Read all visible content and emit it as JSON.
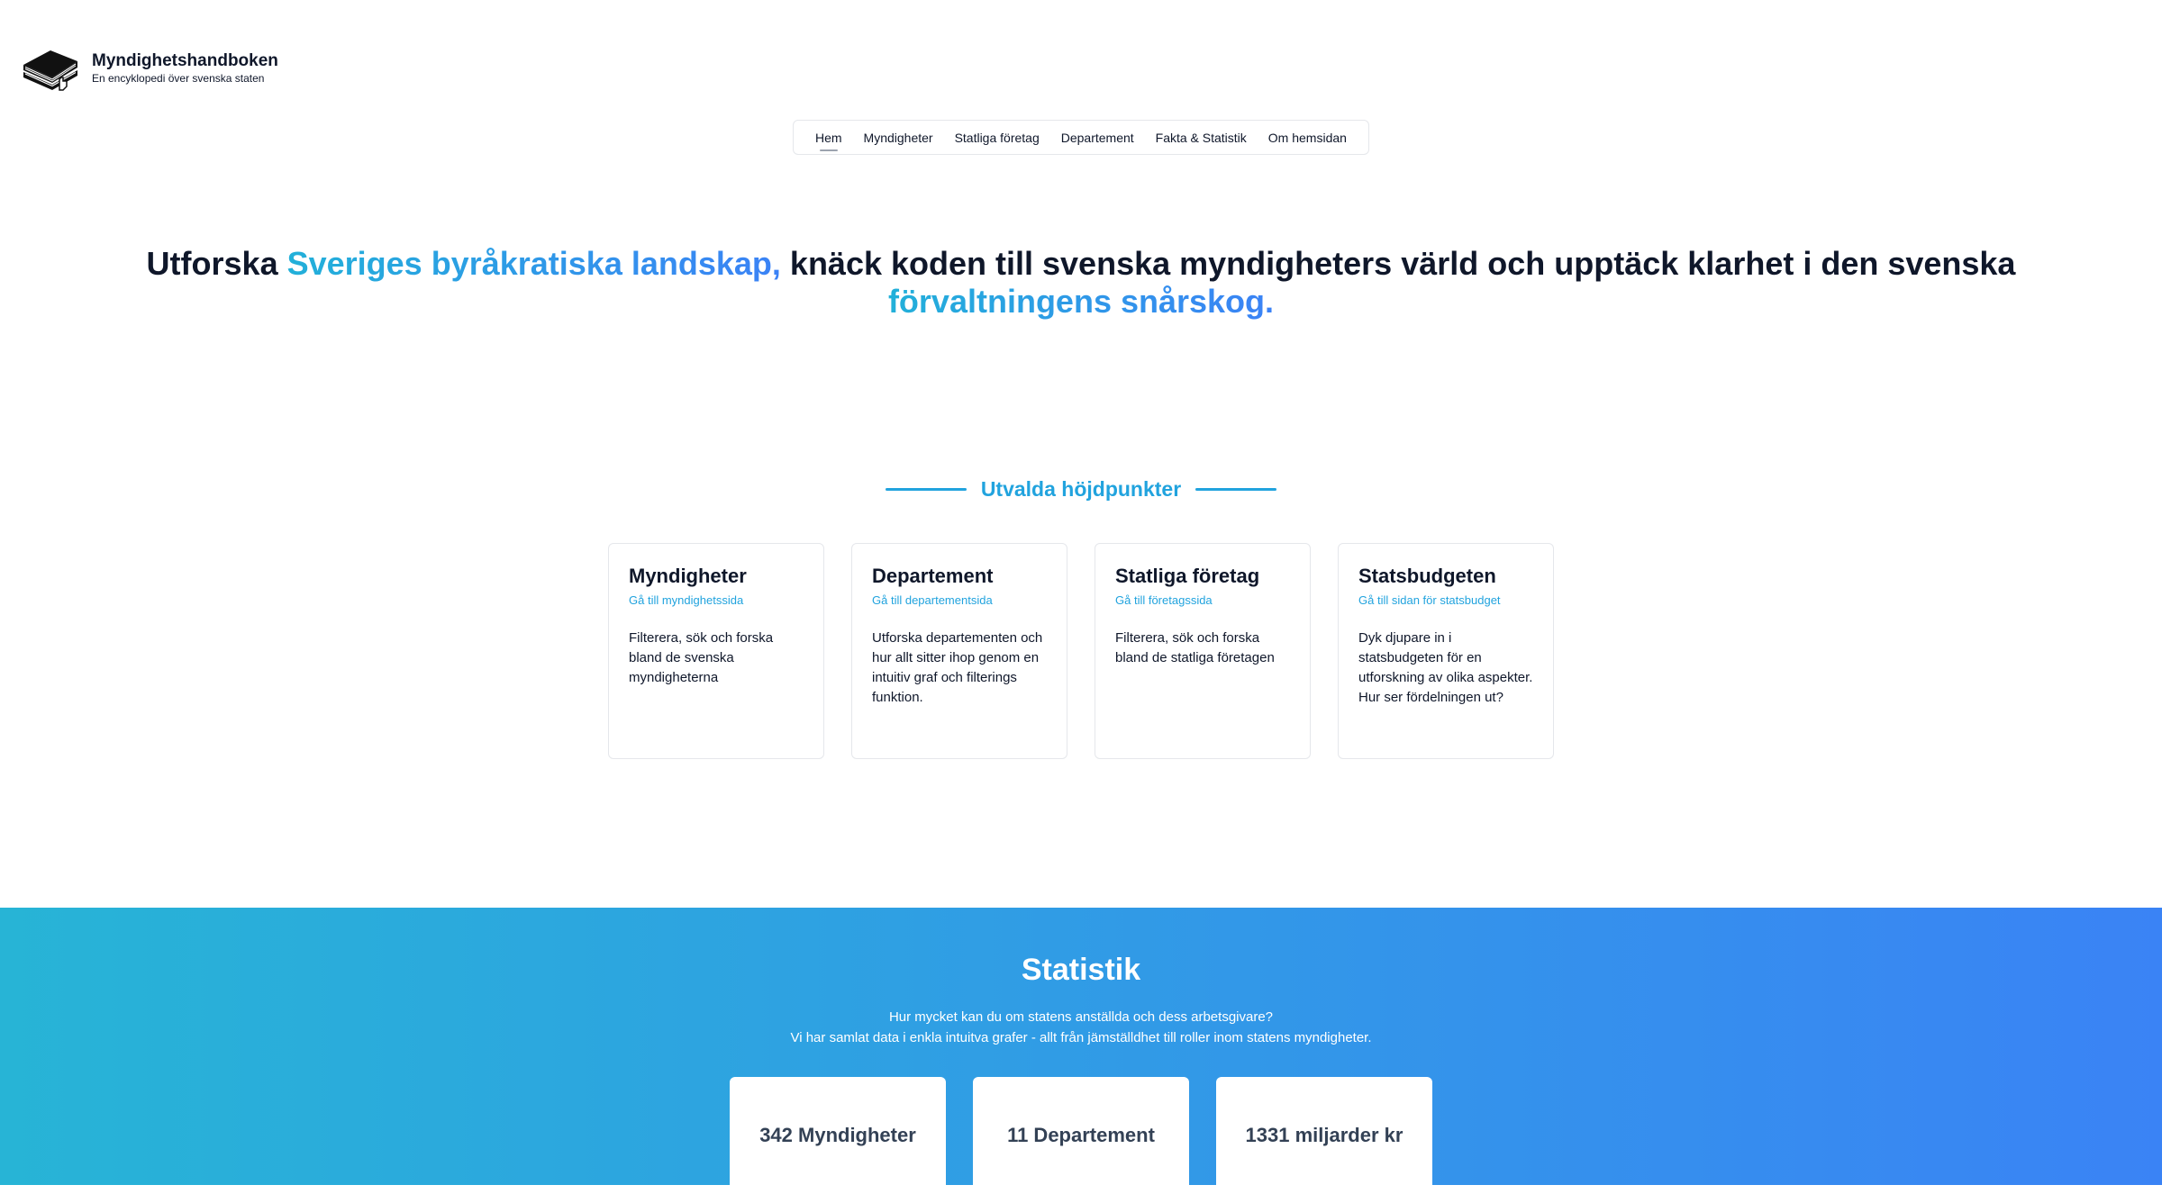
{
  "brand": {
    "title": "Myndighetshandboken",
    "subtitle": "En encyklopedi över svenska staten",
    "icon": "book-stack-icon"
  },
  "nav": {
    "items": [
      {
        "label": "Hem",
        "active": true
      },
      {
        "label": "Myndigheter",
        "active": false
      },
      {
        "label": "Statliga företag",
        "active": false
      },
      {
        "label": "Departement",
        "active": false
      },
      {
        "label": "Fakta & Statistik",
        "active": false
      },
      {
        "label": "Om hemsidan",
        "active": false
      }
    ]
  },
  "hero": {
    "part1": "Utforska ",
    "highlight1": "Sveriges byråkratiska landskap,",
    "part2": " knäck koden till svenska myndigheters värld och upptäck klarhet i den svenska ",
    "highlight2": "förvaltningens snårskog."
  },
  "highlights": {
    "heading": "Utvalda höjdpunkter",
    "cards": [
      {
        "title": "Myndigheter",
        "link": "Gå till myndighetssida",
        "description": "Filterera, sök och forska bland de svenska myndigheterna"
      },
      {
        "title": "Departement",
        "link": "Gå till departementsida",
        "description": "Utforska departementen och hur allt sitter ihop genom en intuitiv graf och filterings funktion."
      },
      {
        "title": "Statliga företag",
        "link": "Gå till företagssida",
        "description": "Filterera, sök och forska bland de statliga företagen"
      },
      {
        "title": "Statsbudgeten",
        "link": "Gå till sidan för statsbudget",
        "description": "Dyk djupare in i statsbudgeten för en utforskning av olika aspekter. Hur ser fördelningen ut?"
      }
    ]
  },
  "stats": {
    "title": "Statistik",
    "line1": "Hur mycket kan du om statens anställda och dess arbetsgivare?",
    "line2": "Vi har samlat data i enkla intuitva grafer - allt från jämställdhet till roller inom statens myndigheter.",
    "boxes": [
      "342 Myndigheter",
      "11 Departement",
      "1331 miljarder kr"
    ]
  },
  "colors": {
    "accent": "#21a3de",
    "gradient_start": "#27b4d6",
    "gradient_end": "#3a83f5"
  }
}
